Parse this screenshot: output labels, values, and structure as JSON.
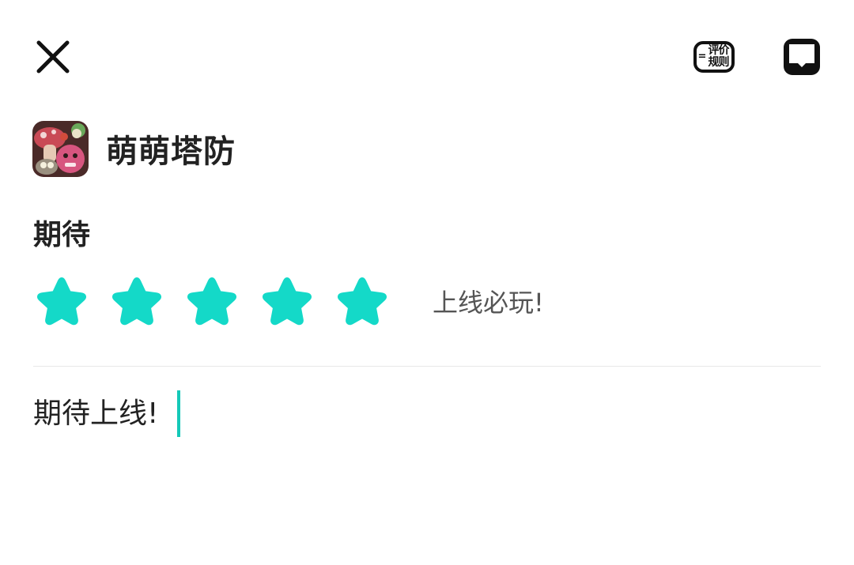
{
  "header": {
    "close_icon": "close-icon",
    "rules_label_line1": "评价",
    "rules_label_line2": "规则",
    "feedback_icon": "feedback-icon"
  },
  "app": {
    "name": "萌萌塔防",
    "icon": "game-app-icon"
  },
  "rating": {
    "label": "期待",
    "stars_total": 5,
    "stars_selected": 5,
    "star_color": "#14d9c8",
    "description": "上线必玩!"
  },
  "review": {
    "text": "期待上线!",
    "caret_color": "#14c9b8"
  }
}
